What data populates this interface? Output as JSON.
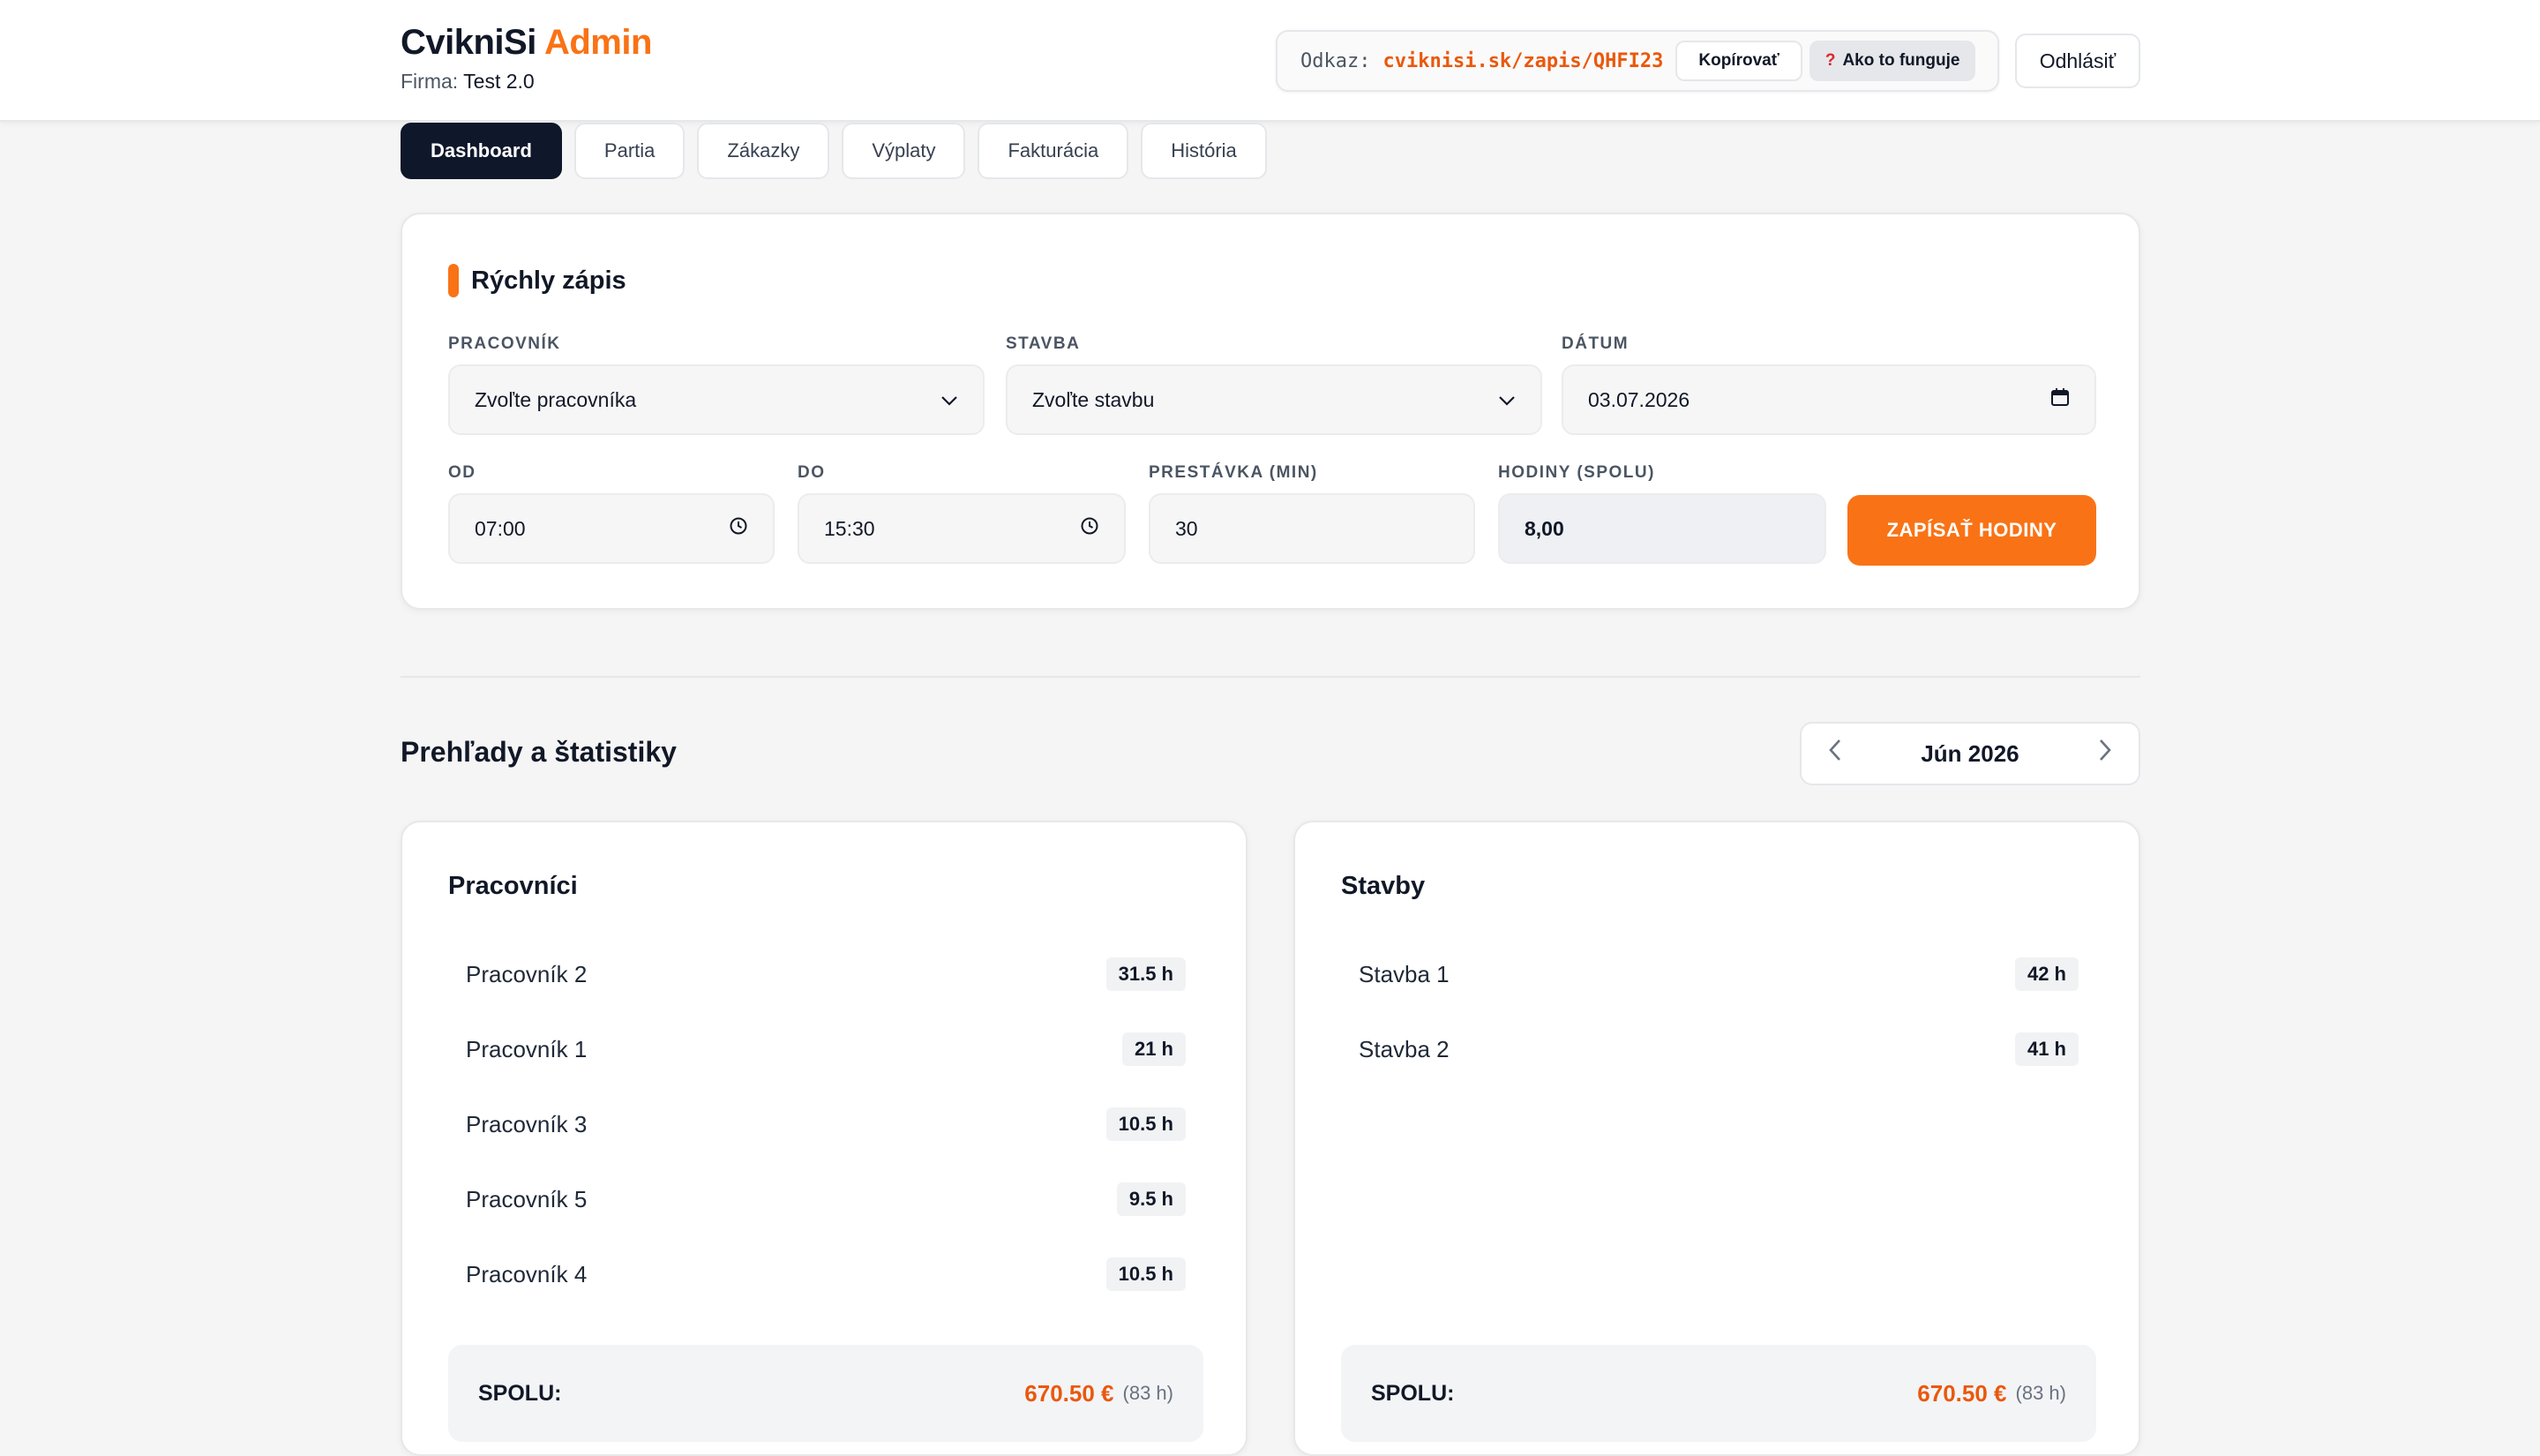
{
  "header": {
    "brand_main": "CvikniSi",
    "brand_accent": "Admin",
    "firm_label": "Firma:",
    "firm_name": "Test 2.0",
    "link_label": "Odkaz:",
    "link_url": "cviknisi.sk/zapis/QHFI23",
    "copy_label": "Kopírovať",
    "help_icon": "?",
    "help_label": "Ako to funguje",
    "logout_label": "Odhlásiť"
  },
  "tabs": [
    {
      "label": "Dashboard",
      "active": true
    },
    {
      "label": "Partia"
    },
    {
      "label": "Zákazky"
    },
    {
      "label": "Výplaty"
    },
    {
      "label": "Fakturácia"
    },
    {
      "label": "História"
    }
  ],
  "quick_entry": {
    "title": "Rýchly zápis",
    "worker": {
      "label": "PRACOVNÍK",
      "value": "Zvoľte pracovníka"
    },
    "site": {
      "label": "STAVBA",
      "value": "Zvoľte stavbu"
    },
    "date": {
      "label": "DÁTUM",
      "value": "03.07.2026"
    },
    "from": {
      "label": "OD",
      "value": "07:00"
    },
    "to": {
      "label": "DO",
      "value": "15:30"
    },
    "break": {
      "label": "PRESTÁVKA (MIN)",
      "value": "30"
    },
    "hours": {
      "label": "HODINY (SPOLU)",
      "value": "8,00"
    },
    "submit_label": "ZAPÍSAŤ HODINY"
  },
  "overview": {
    "title": "Prehľady a štatistiky",
    "month": "Jún 2026"
  },
  "workers_card": {
    "title": "Pracovníci",
    "rows": [
      {
        "name": "Pracovník 2",
        "hours": "31.5 h"
      },
      {
        "name": "Pracovník 1",
        "hours": "21 h"
      },
      {
        "name": "Pracovník 3",
        "hours": "10.5 h"
      },
      {
        "name": "Pracovník 5",
        "hours": "9.5 h"
      },
      {
        "name": "Pracovník 4",
        "hours": "10.5 h"
      }
    ],
    "total_label": "SPOLU:",
    "total_amount": "670.50 €",
    "total_hours": "(83 h)"
  },
  "sites_card": {
    "title": "Stavby",
    "rows": [
      {
        "name": "Stavba 1",
        "hours": "42 h"
      },
      {
        "name": "Stavba 2",
        "hours": "41 h"
      }
    ],
    "total_label": "SPOLU:",
    "total_amount": "670.50 €",
    "total_hours": "(83 h)"
  },
  "colors": {
    "accent": "#f97316",
    "dark": "#0f172a"
  }
}
